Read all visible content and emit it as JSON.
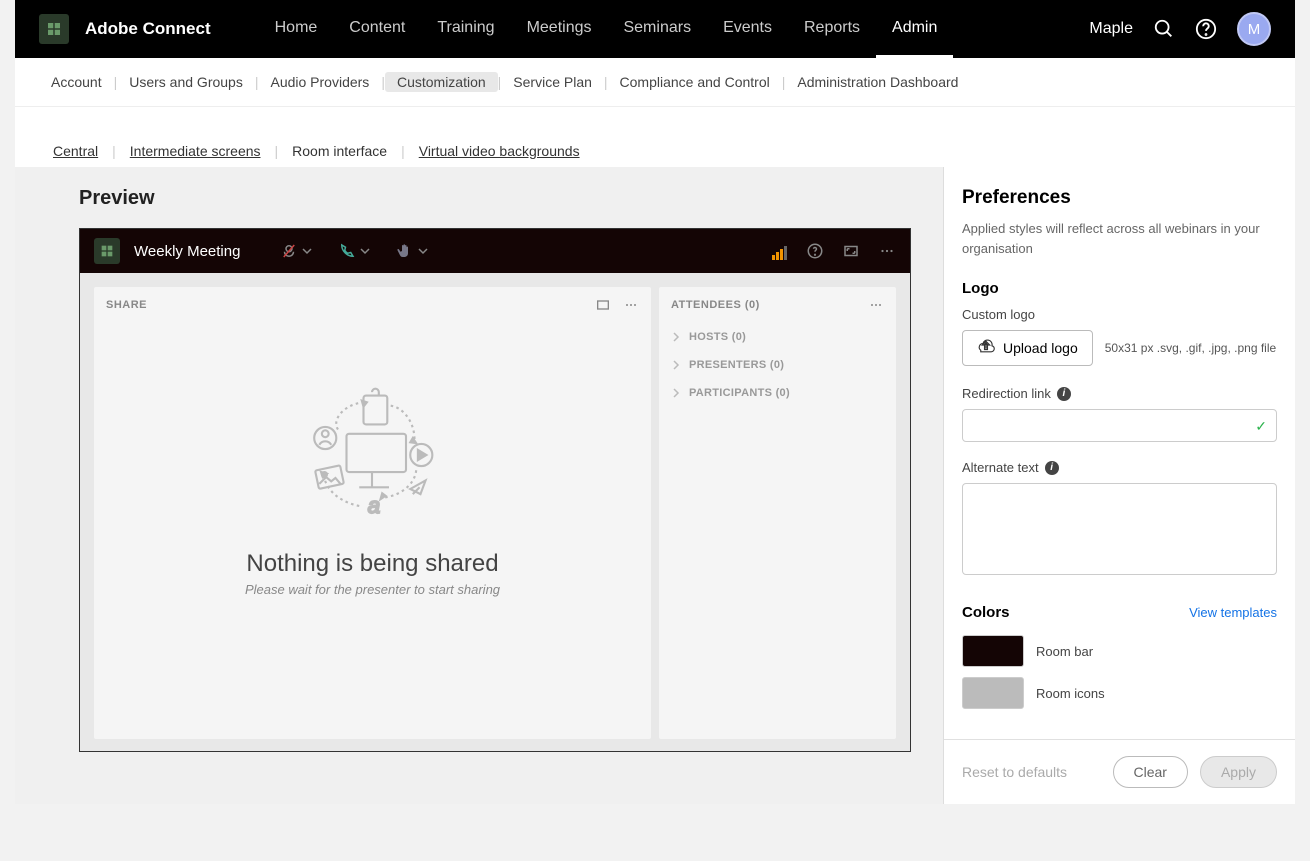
{
  "app_title": "Adobe Connect",
  "main_nav": [
    "Home",
    "Content",
    "Training",
    "Meetings",
    "Seminars",
    "Events",
    "Reports",
    "Admin"
  ],
  "main_nav_active": 7,
  "user_name": "Maple",
  "avatar_letter": "M",
  "subnav": [
    "Account",
    "Users and Groups",
    "Audio Providers",
    "Customization",
    "Service Plan",
    "Compliance and Control",
    "Administration Dashboard"
  ],
  "subnav_active": 3,
  "subnav2": [
    "Central",
    "Intermediate screens",
    "Room interface",
    "Virtual video backgrounds"
  ],
  "subnav2_active": 2,
  "preview": {
    "title": "Preview",
    "room_title": "Weekly Meeting",
    "share_label": "SHARE",
    "attendees_label": "ATTENDEES (0)",
    "groups": [
      "HOSTS (0)",
      "PRESENTERS (0)",
      "PARTICIPANTS (0)"
    ],
    "share_msg": "Nothing is being shared",
    "share_sub": "Please wait for the presenter to start sharing"
  },
  "prefs": {
    "title": "Preferences",
    "desc": "Applied styles will reflect across all webinars in your organisation",
    "logo_label": "Logo",
    "custom_logo_label": "Custom logo",
    "upload_btn": "Upload logo",
    "upload_hint": "50x31 px .svg, .gif, .jpg, .png file",
    "redirect_label": "Redirection link",
    "alt_label": "Alternate text",
    "colors_label": "Colors",
    "view_templates": "View templates",
    "color_rows": [
      {
        "label": "Room bar",
        "hex": "#140505"
      },
      {
        "label": "Room icons",
        "hex": "#bbbbbb"
      }
    ],
    "reset": "Reset to defaults",
    "clear": "Clear",
    "apply": "Apply"
  }
}
